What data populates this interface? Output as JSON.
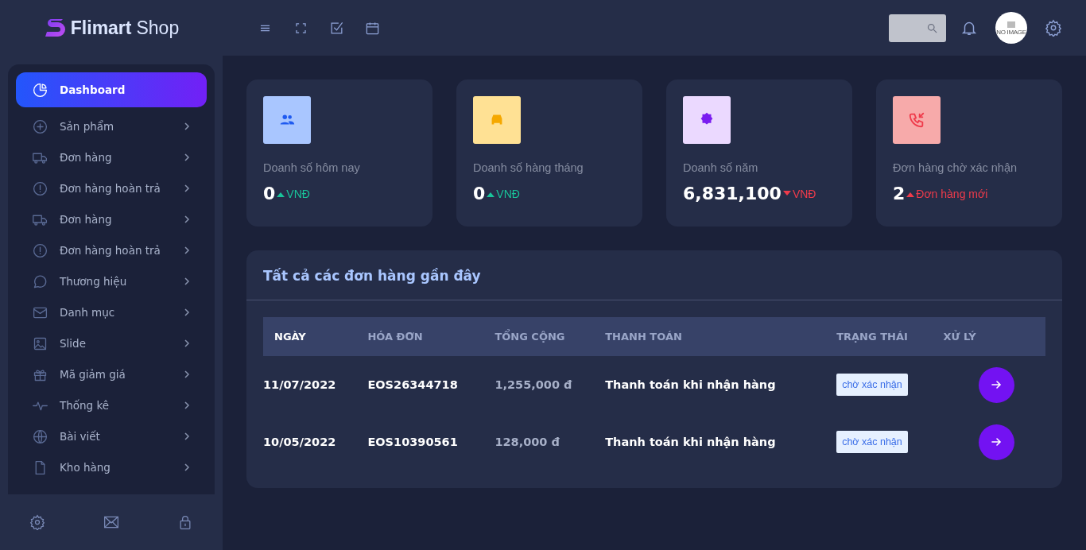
{
  "brand": {
    "name": "Flimart",
    "suffix": "Shop"
  },
  "sidebar": {
    "items": [
      {
        "label": "Dashboard",
        "selected": true
      },
      {
        "label": "Sản phẩm",
        "selected": false
      },
      {
        "label": "Đơn hàng",
        "selected": false
      },
      {
        "label": "Đơn hàng hoàn trả",
        "selected": false
      },
      {
        "label": "Đơn hàng",
        "selected": false
      },
      {
        "label": "Đơn hàng hoàn trả",
        "selected": false
      },
      {
        "label": "Thương hiệu",
        "selected": false
      },
      {
        "label": "Danh mục",
        "selected": false
      },
      {
        "label": "Slide",
        "selected": false
      },
      {
        "label": "Mã giảm giá",
        "selected": false
      },
      {
        "label": "Thống kê",
        "selected": false
      },
      {
        "label": "Bài viết",
        "selected": false
      },
      {
        "label": "Kho hàng",
        "selected": false
      }
    ]
  },
  "avatar": {
    "text": "NO IMAGE"
  },
  "stats": [
    {
      "color": "#a9c6ff",
      "label": "Doanh số hôm nay",
      "value": "0",
      "kind": "rise",
      "unit": "VNĐ"
    },
    {
      "color": "#ffe194",
      "label": "Doanh số hàng tháng",
      "value": "0",
      "kind": "rise",
      "unit": "VNĐ"
    },
    {
      "color": "#ebd9ff",
      "label": "Doanh số năm",
      "value": "6,831,100",
      "kind": "fall",
      "unit": "VNĐ"
    },
    {
      "color": "#f7aaaa",
      "label": "Đơn hàng chờ xác nhận",
      "value": "2",
      "kind": "alert",
      "unit": "Đơn hàng mới"
    }
  ],
  "orders": {
    "title": "Tất cả các đơn hàng gần đây",
    "columns": [
      "NGÀY",
      "HÓA ĐƠN",
      "TỔNG CỘNG",
      "THANH TOÁN",
      "TRẠNG THÁI",
      "XỬ LÝ"
    ],
    "rows": [
      {
        "date": "11/07/2022",
        "invoice": "EOS26344718",
        "total": "1,255,000 đ",
        "payment": "Thanh toán khi nhận hàng",
        "status": "chờ xác nhận"
      },
      {
        "date": "10/05/2022",
        "invoice": "EOS10390561",
        "total": "128,000 đ",
        "payment": "Thanh toán khi nhận hàng",
        "status": "chờ xác nhận"
      }
    ]
  }
}
